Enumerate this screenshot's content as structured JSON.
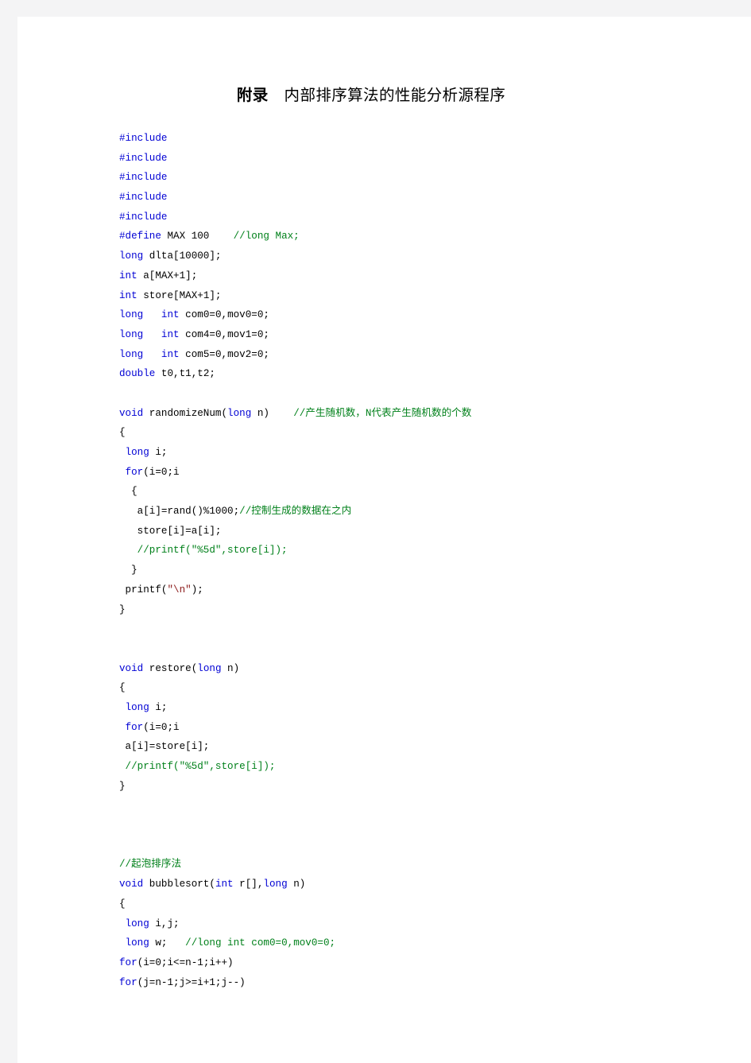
{
  "document": {
    "title_bold": "附录",
    "title_rest": "　内部排序算法的性能分析源程序",
    "title_full": "附录　内部排序算法的性能分析源程序"
  },
  "colors": {
    "keyword": "#0000d4",
    "comment": "#00801a",
    "string": "#8b1a1a",
    "plain": "#000000",
    "page_background": "#ffffff",
    "canvas_background": "#f4f4f5"
  },
  "code": {
    "lines": [
      {
        "indent": 0,
        "segments": [
          {
            "cls": "kw",
            "text": "#include"
          }
        ]
      },
      {
        "indent": 0,
        "segments": [
          {
            "cls": "kw",
            "text": "#include"
          }
        ]
      },
      {
        "indent": 0,
        "segments": [
          {
            "cls": "kw",
            "text": "#include"
          }
        ]
      },
      {
        "indent": 0,
        "segments": [
          {
            "cls": "kw",
            "text": "#include"
          }
        ]
      },
      {
        "indent": 0,
        "segments": [
          {
            "cls": "kw",
            "text": "#include"
          }
        ]
      },
      {
        "indent": 0,
        "segments": [
          {
            "cls": "kw",
            "text": "#define"
          },
          {
            "cls": "pln",
            "text": " MAX 100    "
          },
          {
            "cls": "cmt",
            "text": "//long Max;"
          }
        ]
      },
      {
        "indent": 0,
        "segments": [
          {
            "cls": "kw",
            "text": "long"
          },
          {
            "cls": "pln",
            "text": " dlta[10000];"
          }
        ]
      },
      {
        "indent": 0,
        "segments": [
          {
            "cls": "kw",
            "text": "int"
          },
          {
            "cls": "pln",
            "text": " a[MAX+1];"
          }
        ]
      },
      {
        "indent": 0,
        "segments": [
          {
            "cls": "kw",
            "text": "int"
          },
          {
            "cls": "pln",
            "text": " store[MAX+1];"
          }
        ]
      },
      {
        "indent": 0,
        "segments": [
          {
            "cls": "kw",
            "text": "long"
          },
          {
            "cls": "pln",
            "text": "   "
          },
          {
            "cls": "kw",
            "text": "int"
          },
          {
            "cls": "pln",
            "text": " com0=0,mov0=0;"
          }
        ]
      },
      {
        "indent": 0,
        "segments": [
          {
            "cls": "kw",
            "text": "long"
          },
          {
            "cls": "pln",
            "text": "   "
          },
          {
            "cls": "kw",
            "text": "int"
          },
          {
            "cls": "pln",
            "text": " com4=0,mov1=0;"
          }
        ]
      },
      {
        "indent": 0,
        "segments": [
          {
            "cls": "kw",
            "text": "long"
          },
          {
            "cls": "pln",
            "text": "   "
          },
          {
            "cls": "kw",
            "text": "int"
          },
          {
            "cls": "pln",
            "text": " com5=0,mov2=0;"
          }
        ]
      },
      {
        "indent": 0,
        "segments": [
          {
            "cls": "kw",
            "text": "double"
          },
          {
            "cls": "pln",
            "text": " t0,t1,t2;"
          }
        ]
      },
      {
        "indent": 0,
        "segments": []
      },
      {
        "indent": 0,
        "segments": [
          {
            "cls": "kw",
            "text": "void"
          },
          {
            "cls": "pln",
            "text": " randomizeNum("
          },
          {
            "cls": "kw",
            "text": "long"
          },
          {
            "cls": "pln",
            "text": " n)    "
          },
          {
            "cls": "cmt",
            "text": "//产生随机数，N代表产生随机数的个数"
          }
        ]
      },
      {
        "indent": 0,
        "segments": [
          {
            "cls": "pln",
            "text": "{"
          }
        ]
      },
      {
        "indent": 0,
        "segments": [
          {
            "cls": "pln",
            "text": " "
          },
          {
            "cls": "kw",
            "text": "long"
          },
          {
            "cls": "pln",
            "text": " i;"
          }
        ]
      },
      {
        "indent": 0,
        "segments": [
          {
            "cls": "pln",
            "text": " "
          },
          {
            "cls": "kw",
            "text": "for"
          },
          {
            "cls": "pln",
            "text": "(i=0;i"
          }
        ]
      },
      {
        "indent": 0,
        "segments": [
          {
            "cls": "pln",
            "text": "  {"
          }
        ]
      },
      {
        "indent": 0,
        "segments": [
          {
            "cls": "pln",
            "text": "   a[i]=rand()%1000;"
          },
          {
            "cls": "cmt",
            "text": "//控制生成的数据在之内"
          }
        ]
      },
      {
        "indent": 0,
        "segments": [
          {
            "cls": "pln",
            "text": "   store[i]=a[i];"
          }
        ]
      },
      {
        "indent": 0,
        "segments": [
          {
            "cls": "cmt",
            "text": "   //printf(\"%5d\",store[i]);"
          }
        ]
      },
      {
        "indent": 0,
        "segments": [
          {
            "cls": "pln",
            "text": "  }"
          }
        ]
      },
      {
        "indent": 0,
        "segments": [
          {
            "cls": "pln",
            "text": " printf("
          },
          {
            "cls": "str",
            "text": "\"\\n\""
          },
          {
            "cls": "pln",
            "text": ");"
          }
        ]
      },
      {
        "indent": 0,
        "segments": [
          {
            "cls": "pln",
            "text": "}"
          }
        ]
      },
      {
        "indent": 0,
        "segments": []
      },
      {
        "indent": 0,
        "segments": []
      },
      {
        "indent": 0,
        "segments": [
          {
            "cls": "kw",
            "text": "void"
          },
          {
            "cls": "pln",
            "text": " restore("
          },
          {
            "cls": "kw",
            "text": "long"
          },
          {
            "cls": "pln",
            "text": " n)"
          }
        ]
      },
      {
        "indent": 0,
        "segments": [
          {
            "cls": "pln",
            "text": "{"
          }
        ]
      },
      {
        "indent": 0,
        "segments": [
          {
            "cls": "pln",
            "text": " "
          },
          {
            "cls": "kw",
            "text": "long"
          },
          {
            "cls": "pln",
            "text": " i;"
          }
        ]
      },
      {
        "indent": 0,
        "segments": [
          {
            "cls": "pln",
            "text": " "
          },
          {
            "cls": "kw",
            "text": "for"
          },
          {
            "cls": "pln",
            "text": "(i=0;i"
          }
        ]
      },
      {
        "indent": 0,
        "segments": [
          {
            "cls": "pln",
            "text": " a[i]=store[i];"
          }
        ]
      },
      {
        "indent": 0,
        "segments": [
          {
            "cls": "cmt",
            "text": " //printf(\"%5d\",store[i]);"
          }
        ]
      },
      {
        "indent": 0,
        "segments": [
          {
            "cls": "pln",
            "text": "}"
          }
        ]
      },
      {
        "indent": 0,
        "segments": []
      },
      {
        "indent": 0,
        "segments": []
      },
      {
        "indent": 0,
        "segments": []
      },
      {
        "indent": 0,
        "segments": [
          {
            "cls": "cmt",
            "text": "//起泡排序法"
          }
        ]
      },
      {
        "indent": 0,
        "segments": [
          {
            "cls": "kw",
            "text": "void"
          },
          {
            "cls": "pln",
            "text": " bubblesort("
          },
          {
            "cls": "kw",
            "text": "int"
          },
          {
            "cls": "pln",
            "text": " r[],"
          },
          {
            "cls": "kw",
            "text": "long"
          },
          {
            "cls": "pln",
            "text": " n)"
          }
        ]
      },
      {
        "indent": 0,
        "segments": [
          {
            "cls": "pln",
            "text": "{"
          }
        ]
      },
      {
        "indent": 0,
        "segments": [
          {
            "cls": "pln",
            "text": " "
          },
          {
            "cls": "kw",
            "text": "long"
          },
          {
            "cls": "pln",
            "text": " i,j;"
          }
        ]
      },
      {
        "indent": 0,
        "segments": [
          {
            "cls": "pln",
            "text": " "
          },
          {
            "cls": "kw",
            "text": "long"
          },
          {
            "cls": "pln",
            "text": " w;   "
          },
          {
            "cls": "cmt",
            "text": "//long int com0=0,mov0=0;"
          }
        ]
      },
      {
        "indent": 0,
        "segments": [
          {
            "cls": "kw",
            "text": "for"
          },
          {
            "cls": "pln",
            "text": "(i=0;i<=n-1;i++)"
          }
        ]
      },
      {
        "indent": 0,
        "segments": [
          {
            "cls": "kw",
            "text": "for"
          },
          {
            "cls": "pln",
            "text": "(j=n-1;j>=i+1;j--)"
          }
        ]
      }
    ]
  }
}
